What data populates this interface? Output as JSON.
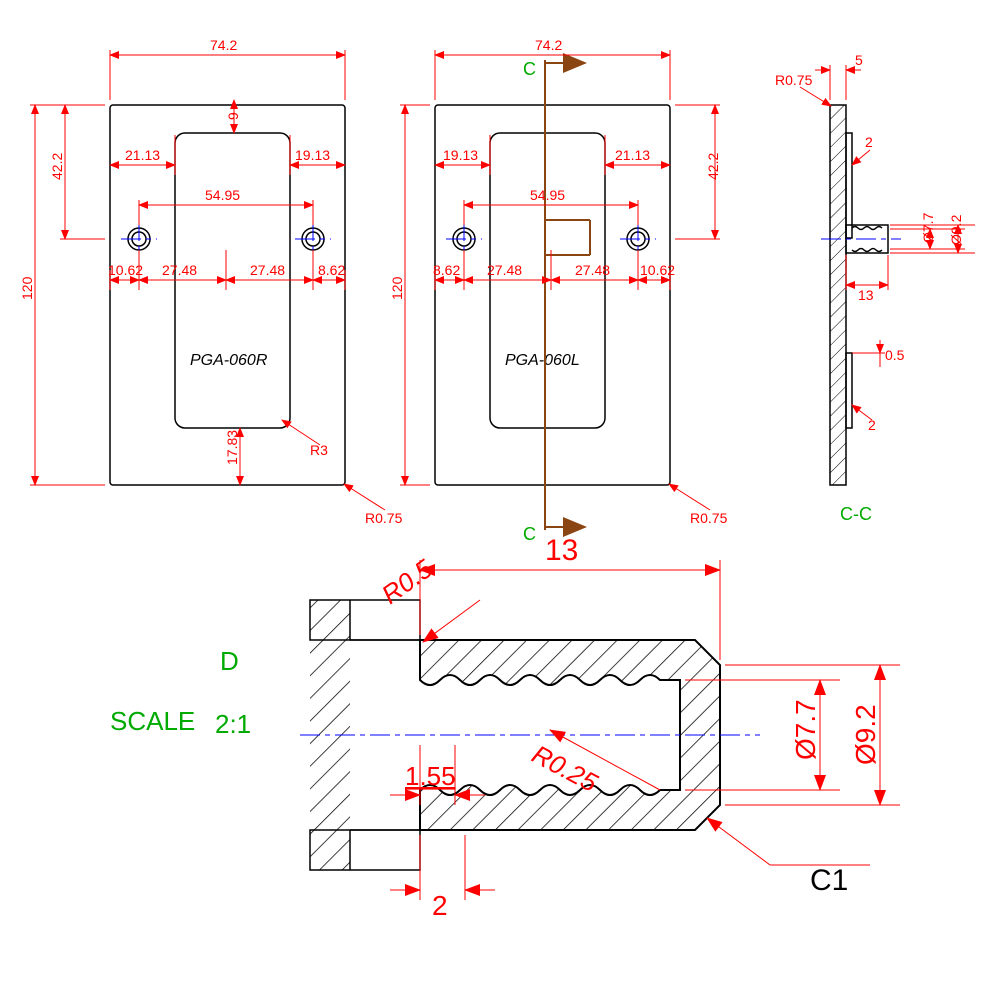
{
  "views": {
    "left": {
      "part_label": "PGA-060R",
      "dims": {
        "width_top": "74.2",
        "height_left": "120",
        "top_to_hole": "42.2",
        "hole_spacing": "54.95",
        "left_margin_top": "21.13",
        "right_margin_top": "19.13",
        "left_margin_bot": "10.62",
        "half_left": "27.48",
        "half_right": "27.48",
        "right_margin_bot": "8.62",
        "bottom_margin": "17.83",
        "top_margin": "9",
        "radius_inner": "R3",
        "radius_outer": "R0.75"
      }
    },
    "middle": {
      "part_label": "PGA-060L",
      "section_mark": "C",
      "dims": {
        "width_top": "74.2",
        "height_left": "120",
        "top_to_hole": "42.2",
        "hole_spacing": "54.95",
        "left_margin_top": "19.13",
        "right_margin_top": "21.13",
        "left_margin_bot": "8.62",
        "half_left": "27.48",
        "half_right": "27.48",
        "right_margin_bot": "10.62",
        "radius_outer": "R0.75"
      }
    },
    "section": {
      "label": "C-C",
      "dims": {
        "thickness_top": "5",
        "radius_top": "R0.75",
        "rib": "2",
        "boss_len": "13",
        "thread_minor": "Ø7.7",
        "thread_major": "Ø9.2",
        "step": "0.5",
        "rib2": "2"
      }
    },
    "detail": {
      "label": "D",
      "scale": "SCALE 2:1",
      "dims": {
        "boss_len": "13",
        "r_top": "R0.5",
        "r_mid": "R0.25",
        "pitch": "1.55",
        "wall": "2",
        "thread_minor": "Ø7.7",
        "thread_major": "Ø9.2",
        "chamfer": "C1"
      }
    }
  }
}
